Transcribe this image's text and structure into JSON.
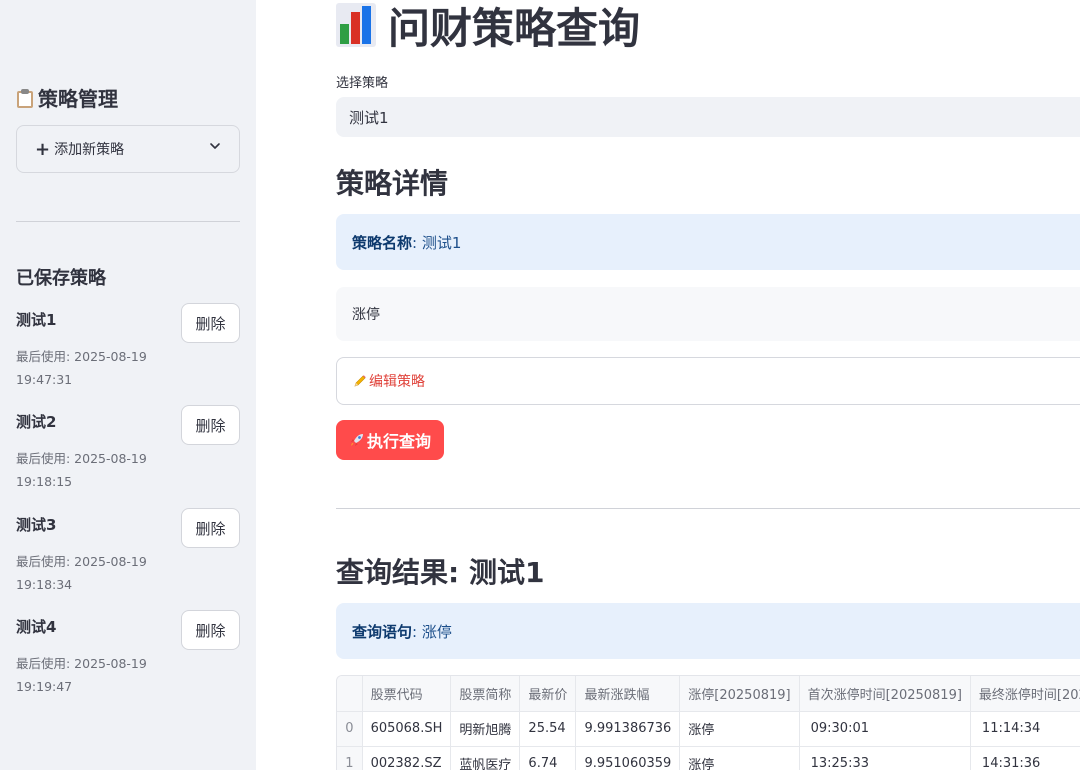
{
  "sidebar": {
    "title": "策略管理",
    "add_expander_label": "添加新策略",
    "saved_title": "已保存策略",
    "delete_label": "删除",
    "strategies": [
      {
        "name": "测试1",
        "meta_line1": "最后使用: 2025-08-19",
        "meta_line2": "19:47:31"
      },
      {
        "name": "测试2",
        "meta_line1": "最后使用: 2025-08-19",
        "meta_line2": "19:18:15"
      },
      {
        "name": "测试3",
        "meta_line1": "最后使用: 2025-08-19",
        "meta_line2": "19:18:34"
      },
      {
        "name": "测试4",
        "meta_line1": "最后使用: 2025-08-19",
        "meta_line2": "19:19:47"
      }
    ]
  },
  "main": {
    "title": "问财策略查询",
    "select_label": "选择策略",
    "select_value": "测试1",
    "details_heading": "策略详情",
    "name_label": "策略名称",
    "name_value": ": 测试1",
    "query_text": "涨停",
    "edit_label": "编辑策略",
    "run_label": "执行查询",
    "results_heading": "查询结果: 测试1",
    "query_label": "查询语句",
    "query_value": ": 涨停"
  },
  "table": {
    "headers": [
      "",
      "股票代码",
      "股票简称",
      "最新价",
      "最新涨跌幅",
      "涨停[20250819]",
      "首次涨停时间[20250819]",
      "最终涨停时间[202"
    ],
    "rows": [
      [
        "0",
        "605068.SH",
        "明新旭腾",
        "25.54",
        "9.991386736",
        "涨停",
        "09:30:01",
        "11:14:34"
      ],
      [
        "1",
        "002382.SZ",
        "蓝帆医疗",
        "6.74",
        "9.951060359",
        "涨停",
        "13:25:33",
        "14:31:36"
      ]
    ]
  },
  "colors": {
    "accent": "#ff4b4b",
    "sidebar_bg": "#f0f2f6",
    "info_bg": "#e7f0fc",
    "info_text": "#1d4f8b"
  },
  "icons": {
    "sidebar_title": "clipboard-icon",
    "page_title": "bar-chart-icon",
    "expander_chevron": "chevron-down-icon",
    "edit": "pencil-icon",
    "run": "rocket-icon"
  }
}
